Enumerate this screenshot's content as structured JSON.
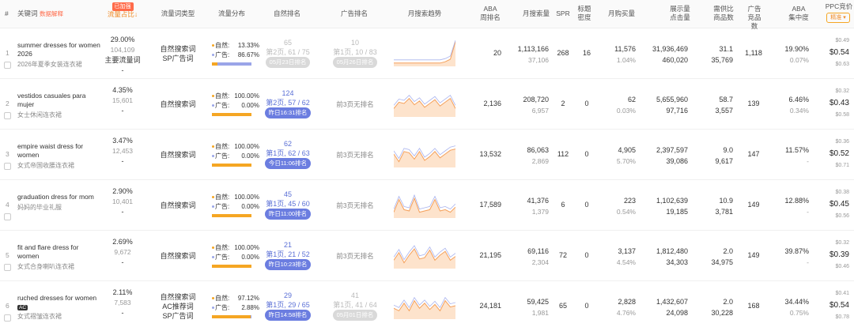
{
  "header": {
    "hash": "#",
    "keyword": "关键词",
    "data_explain": "数据解释",
    "traffic_share": "流量占比",
    "traffic_share_tag": "已加强",
    "keyword_type": "流量词类型",
    "traffic_dist": "流量分布",
    "organic_rank": "自然排名",
    "ad_rank": "广告排名",
    "monthly_trend": "月搜索趋势",
    "aba_rank": "ABA\n周排名",
    "monthly_search": "月搜索量",
    "spr": "SPR",
    "title_density": "标题\n密度",
    "monthly_purchase": "月购买量",
    "impressions_clicks": "展示量\n点击量",
    "supply_demand": "需供比\n商品数",
    "ad_products": "广告\n竞品数",
    "aba_concentration": "ABA\n集中度",
    "ppc_bid": "PPC竞价",
    "ppc_mode": "精准"
  },
  "labels": {
    "organic": "自然:",
    "ad": "广告:",
    "ad_none": "前3页无排名"
  },
  "rows": [
    {
      "idx": "1",
      "kw_en": "summer dresses for women 2026",
      "kw_zh": "2026年夏季女装连衣裙",
      "share": "29.00%",
      "share_sub": "104,109",
      "share_tag": "主要流量词",
      "share_dash": "-",
      "type1": "自然搜索词",
      "type2": "SP广告词",
      "organic_pct": "13.33%",
      "ad_pct": "86.67%",
      "organic_share": 0.1333,
      "org_rank": "65",
      "org_page": "第2页, 61 / 75",
      "org_badge": "05月23日排名",
      "org_faded": true,
      "ad_rank": "10",
      "ad_page": "第1页, 10 / 83",
      "ad_badge": "05月26日排名",
      "ad_faded": true,
      "aba": "20",
      "search": "1,113,166",
      "search_sub": "37,106",
      "spr": "268",
      "density": "16",
      "purchase": "11,576",
      "purchase_sub": "1.04%",
      "impr": "31,936,469",
      "clicks": "460,020",
      "sd": "31.1",
      "products": "35,769",
      "adp": "1,118",
      "conc": "19.90%",
      "conc_sub": "0.07%",
      "ppc_hi": "$0.49",
      "ppc": "$0.54",
      "ppc_lo": "$0.63",
      "trend": [
        0.1,
        0.1,
        0.1,
        0.1,
        0.1,
        0.1,
        0.1,
        0.1,
        0.1,
        0.1,
        0.15,
        0.25,
        0.95
      ]
    },
    {
      "idx": "2",
      "kw_en": "vestidos casuales para mujer",
      "kw_zh": "女士休闲连衣裙",
      "share": "4.35%",
      "share_sub": "15,601",
      "share_dash": "-",
      "type1": "自然搜索词",
      "organic_pct": "100.00%",
      "ad_pct": "0.00%",
      "organic_share": 1.0,
      "org_rank": "124",
      "org_page": "第2页, 57 / 62",
      "org_badge": "昨日16:31排名",
      "org_faded": false,
      "ad_none": true,
      "aba": "2,136",
      "search": "208,720",
      "search_sub": "6,957",
      "spr": "2",
      "density": "0",
      "purchase": "62",
      "purchase_sub": "0.03%",
      "impr": "5,655,960",
      "clicks": "97,716",
      "sd": "58.7",
      "products": "3,557",
      "adp": "139",
      "conc": "6.46%",
      "conc_sub": "0.34%",
      "ppc_hi": "$0.32",
      "ppc": "$0.43",
      "ppc_lo": "$0.58",
      "trend": [
        0.3,
        0.55,
        0.5,
        0.7,
        0.45,
        0.6,
        0.35,
        0.5,
        0.65,
        0.4,
        0.55,
        0.7,
        0.3
      ]
    },
    {
      "idx": "3",
      "kw_en": "empire waist dress for women",
      "kw_zh": "女式帝国收腰连衣裙",
      "share": "3.47%",
      "share_sub": "12,453",
      "share_dash": "-",
      "type1": "自然搜索词",
      "organic_pct": "100.00%",
      "ad_pct": "0.00%",
      "organic_share": 1.0,
      "org_rank": "62",
      "org_page": "第1页, 62 / 63",
      "org_badge": "今日11:06排名",
      "org_faded": false,
      "ad_none": true,
      "aba": "13,532",
      "search": "86,063",
      "search_sub": "2,869",
      "spr": "112",
      "density": "0",
      "purchase": "4,905",
      "purchase_sub": "5.70%",
      "impr": "2,397,597",
      "clicks": "39,086",
      "sd": "9.0",
      "products": "9,617",
      "adp": "147",
      "conc": "11.57%",
      "conc_sub": "-",
      "ppc_hi": "$0.36",
      "ppc": "$0.52",
      "ppc_lo": "$0.71",
      "trend": [
        0.5,
        0.2,
        0.6,
        0.55,
        0.3,
        0.6,
        0.25,
        0.4,
        0.6,
        0.35,
        0.5,
        0.65,
        0.7
      ]
    },
    {
      "idx": "4",
      "kw_en": "graduation dress for mom",
      "kw_zh": "妈妈的毕业礼服",
      "share": "2.90%",
      "share_sub": "10,401",
      "share_dash": "-",
      "type1": "自然搜索词",
      "organic_pct": "100.00%",
      "ad_pct": "0.00%",
      "organic_share": 1.0,
      "org_rank": "45",
      "org_page": "第1页, 45 / 60",
      "org_badge": "昨日11:00排名",
      "org_faded": false,
      "ad_none": true,
      "aba": "17,589",
      "search": "41,376",
      "search_sub": "1,379",
      "spr": "6",
      "density": "0",
      "purchase": "223",
      "purchase_sub": "0.54%",
      "impr": "1,102,639",
      "clicks": "19,185",
      "sd": "10.9",
      "products": "3,781",
      "adp": "149",
      "conc": "12.88%",
      "conc_sub": "-",
      "ppc_hi": "$0.38",
      "ppc": "$0.45",
      "ppc_lo": "$0.56",
      "trend": [
        0.2,
        0.7,
        0.3,
        0.25,
        0.75,
        0.2,
        0.25,
        0.3,
        0.7,
        0.25,
        0.3,
        0.2,
        0.4
      ]
    },
    {
      "idx": "5",
      "kw_en": "fit and flare dress for women",
      "kw_zh": "女式合身喇叭连衣裙",
      "share": "2.69%",
      "share_sub": "9,672",
      "share_dash": "-",
      "type1": "自然搜索词",
      "organic_pct": "100.00%",
      "ad_pct": "0.00%",
      "organic_share": 1.0,
      "org_rank": "21",
      "org_page": "第1页, 21 / 52",
      "org_badge": "昨日10:23排名",
      "org_faded": false,
      "ad_none": true,
      "aba": "21,195",
      "search": "69,116",
      "search_sub": "2,304",
      "spr": "72",
      "density": "0",
      "purchase": "3,137",
      "purchase_sub": "4.54%",
      "impr": "1,812,480",
      "clicks": "34,303",
      "sd": "2.0",
      "products": "34,975",
      "adp": "149",
      "conc": "39.87%",
      "conc_sub": "-",
      "ppc_hi": "$0.32",
      "ppc": "$0.39",
      "ppc_lo": "$0.46",
      "trend": [
        0.3,
        0.6,
        0.2,
        0.5,
        0.75,
        0.35,
        0.4,
        0.7,
        0.3,
        0.5,
        0.65,
        0.3,
        0.45
      ]
    },
    {
      "idx": "6",
      "kw_en": "ruched dresses for women",
      "kw_zh": "女式褶皱连衣裙",
      "kw_ac": "AC",
      "share": "2.11%",
      "share_sub": "7,583",
      "share_dash": "-",
      "type1": "自然搜索词",
      "type2": "AC推荐词",
      "type3": "SP广告词",
      "organic_pct": "97.12%",
      "ad_pct": "2.88%",
      "organic_share": 0.9712,
      "org_rank": "29",
      "org_page": "第1页, 29 / 65",
      "org_badge": "昨日14:58排名",
      "org_faded": false,
      "ad_rank": "41",
      "ad_page": "第1页, 41 / 64",
      "ad_badge": "05月01日排名",
      "ad_faded": true,
      "aba": "24,181",
      "search": "59,425",
      "search_sub": "1,981",
      "spr": "65",
      "density": "0",
      "purchase": "2,828",
      "purchase_sub": "4.76%",
      "impr": "1,432,607",
      "clicks": "24,098",
      "sd": "2.0",
      "products": "30,228",
      "adp": "168",
      "conc": "34.44%",
      "conc_sub": "0.75%",
      "ppc_hi": "$0.41",
      "ppc": "$0.54",
      "ppc_lo": "$0.78",
      "trend": [
        0.4,
        0.3,
        0.6,
        0.3,
        0.7,
        0.4,
        0.6,
        0.35,
        0.55,
        0.3,
        0.7,
        0.45,
        0.5
      ]
    }
  ]
}
